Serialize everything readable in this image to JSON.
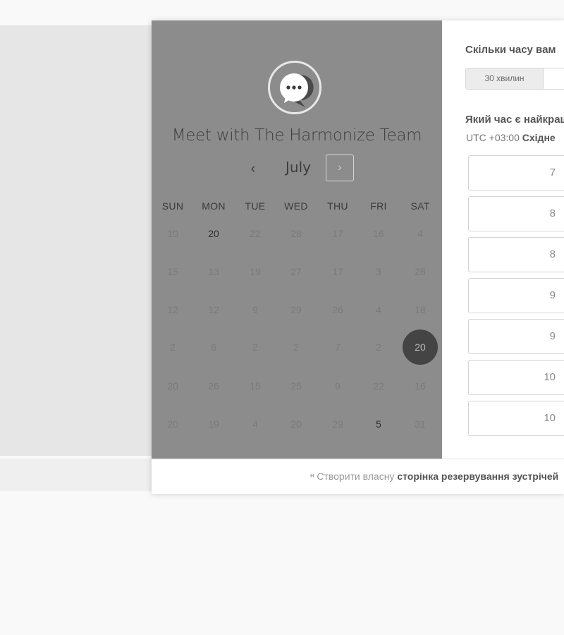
{
  "scheduler": {
    "title": "Meet with The Harmonize Team",
    "month": "July",
    "prev_glyph": "‹",
    "next_glyph": "›",
    "days_of_week": [
      "SUN",
      "MON",
      "TUE",
      "WED",
      "THU",
      "FRI",
      "SAT"
    ],
    "weeks": [
      [
        {
          "d": "10",
          "s": "muted"
        },
        {
          "d": "20",
          "s": "available"
        },
        {
          "d": "22",
          "s": "muted"
        },
        {
          "d": "28",
          "s": "muted"
        },
        {
          "d": "17",
          "s": "muted"
        },
        {
          "d": "16",
          "s": "muted"
        },
        {
          "d": "4",
          "s": "muted"
        }
      ],
      [
        {
          "d": "15",
          "s": "muted"
        },
        {
          "d": "13",
          "s": "muted"
        },
        {
          "d": "19",
          "s": "muted"
        },
        {
          "d": "27",
          "s": "muted"
        },
        {
          "d": "17",
          "s": "muted"
        },
        {
          "d": "3",
          "s": "muted"
        },
        {
          "d": "28",
          "s": "muted"
        }
      ],
      [
        {
          "d": "12",
          "s": "muted"
        },
        {
          "d": "12",
          "s": "muted"
        },
        {
          "d": "9",
          "s": "muted"
        },
        {
          "d": "29",
          "s": "muted"
        },
        {
          "d": "26",
          "s": "muted"
        },
        {
          "d": "4",
          "s": "muted"
        },
        {
          "d": "18",
          "s": "muted"
        }
      ],
      [
        {
          "d": "2",
          "s": "muted"
        },
        {
          "d": "6",
          "s": "muted"
        },
        {
          "d": "2",
          "s": "muted"
        },
        {
          "d": "2",
          "s": "muted"
        },
        {
          "d": "7",
          "s": "muted"
        },
        {
          "d": "2",
          "s": "muted"
        },
        {
          "d": "20",
          "s": "selected"
        }
      ],
      [
        {
          "d": "20",
          "s": "muted"
        },
        {
          "d": "26",
          "s": "muted"
        },
        {
          "d": "15",
          "s": "muted"
        },
        {
          "d": "25",
          "s": "muted"
        },
        {
          "d": "9",
          "s": "muted"
        },
        {
          "d": "22",
          "s": "muted"
        },
        {
          "d": "16",
          "s": "muted"
        }
      ],
      [
        {
          "d": "20",
          "s": "muted"
        },
        {
          "d": "19",
          "s": "muted"
        },
        {
          "d": "4",
          "s": "muted"
        },
        {
          "d": "20",
          "s": "muted"
        },
        {
          "d": "29",
          "s": "muted"
        },
        {
          "d": "5",
          "s": "available"
        },
        {
          "d": "31",
          "s": "muted"
        }
      ]
    ]
  },
  "booking": {
    "duration_question": "Скільки часу вам",
    "duration_options": [
      "30 хвилин"
    ],
    "time_question": "Який час є найкращ",
    "timezone_offset": "UTC +03:00",
    "timezone_name": "Східне",
    "time_slots": [
      "7",
      "8",
      "8",
      "9",
      "9",
      "10",
      "10"
    ]
  },
  "footer": {
    "prefix": "Створити власну",
    "bold": "сторінка резервування зустрічей"
  },
  "colors": {
    "left_panel": "#8c8c8c",
    "selected_day": "#444444",
    "page_background": "#f9f9f9"
  },
  "icons": {
    "avatar": "chat-bubble-icon",
    "footer": "hubspot-sprocket-icon"
  }
}
